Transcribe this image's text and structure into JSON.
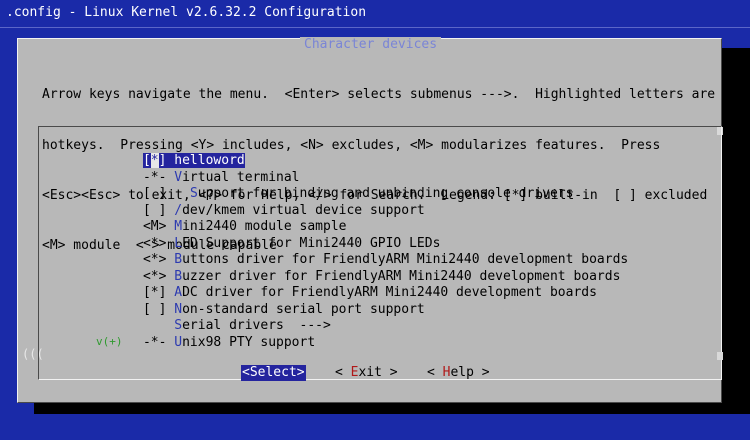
{
  "window": {
    "title": ".config - Linux Kernel v2.6.32.2 Configuration"
  },
  "dialog": {
    "title": "Character devices",
    "help_lines": [
      "Arrow keys navigate the menu.  <Enter> selects submenus --->.  Highlighted letters are",
      "hotkeys.  Pressing <Y> includes, <N> excludes, <M> modularizes features.  Press",
      "<Esc><Esc> to exit, <?> for Help, </> for Search.  Legend: [*] built-in  [ ] excluded",
      "<M> module  < > module capable"
    ],
    "scroll_indicator": "(((",
    "more_indicator": "v(+)"
  },
  "menu": {
    "items": [
      {
        "prefix": "[*]",
        "hot": "h",
        "rest": "elloword",
        "selected": true
      },
      {
        "prefix": "-*-",
        "hot": "V",
        "rest": "irtual terminal"
      },
      {
        "prefix": "[ ]",
        "hot": "S",
        "rest": "upport for binding and unbinding console drivers",
        "indent": "  "
      },
      {
        "prefix": "[ ]",
        "hot": "/",
        "rest": "dev/kmem virtual device support"
      },
      {
        "prefix": "<M>",
        "hot": "M",
        "rest": "ini2440 module sample"
      },
      {
        "prefix": "<*>",
        "hot": "L",
        "rest": "ED Support for Mini2440 GPIO LEDs"
      },
      {
        "prefix": "<*>",
        "hot": "B",
        "rest": "uttons driver for FriendlyARM Mini2440 development boards"
      },
      {
        "prefix": "<*>",
        "hot": "B",
        "rest": "uzzer driver for FriendlyARM Mini2440 development boards"
      },
      {
        "prefix": "[*]",
        "hot": "A",
        "rest": "DC driver for FriendlyARM Mini2440 development boards"
      },
      {
        "prefix": "[ ]",
        "hot": "N",
        "rest": "on-standard serial port support"
      },
      {
        "prefix": "   ",
        "hot": "S",
        "rest": "erial drivers  --->"
      },
      {
        "prefix": "-*-",
        "hot": "U",
        "rest": "nix98 PTY support"
      }
    ]
  },
  "buttons": {
    "select": "<Select>",
    "exit_pre": "< ",
    "exit_hot": "E",
    "exit_rest": "xit >",
    "help_pre": "< ",
    "help_hot": "H",
    "help_rest": "elp >"
  },
  "colors": {
    "background": "#1a2aa8",
    "dialog": "#b8b8b8",
    "highlight": "#24249e",
    "hotkey": "#2c3ab0",
    "button_hotkey": "#b01818",
    "title": "#7a85d6"
  }
}
